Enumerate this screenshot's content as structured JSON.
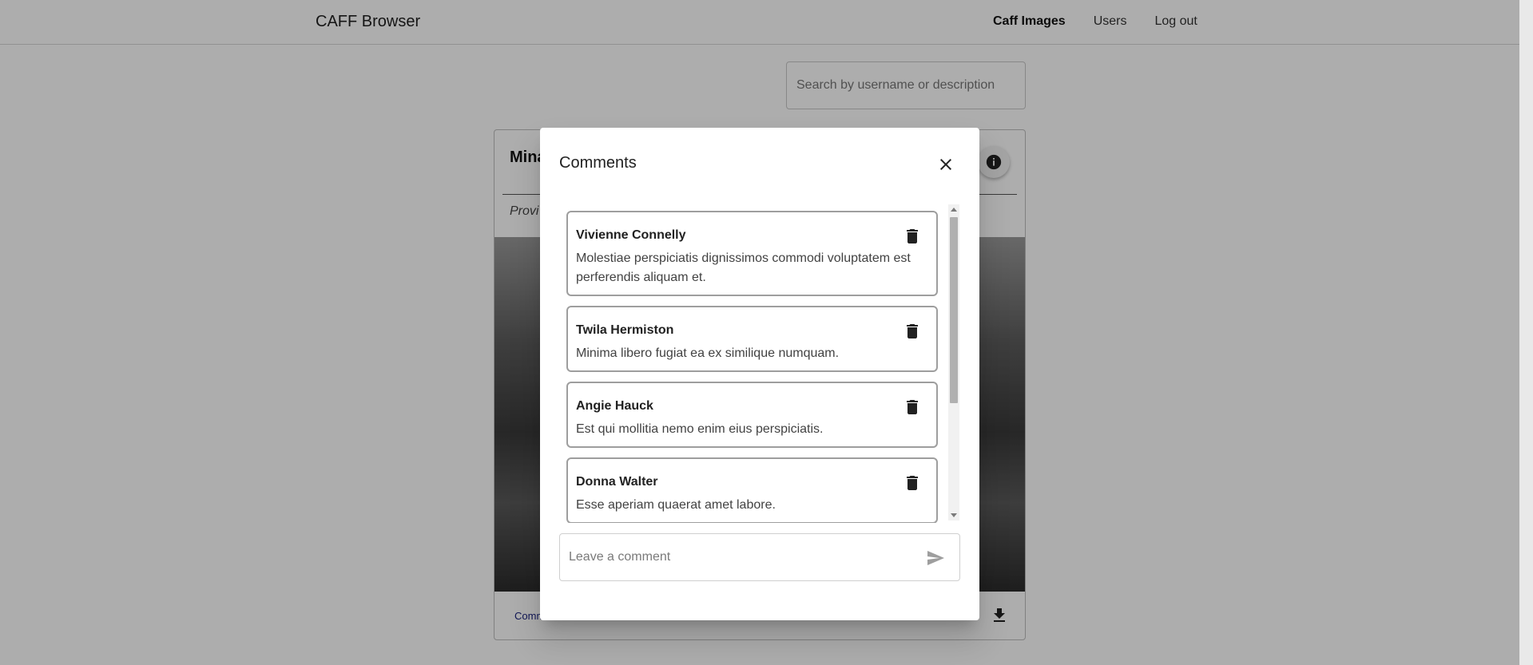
{
  "navbar": {
    "brand": "CAFF Browser",
    "links": [
      {
        "label": "Caff Images",
        "active": true
      },
      {
        "label": "Users",
        "active": false
      },
      {
        "label": "Log out",
        "active": false
      }
    ]
  },
  "search": {
    "placeholder": "Search by username or description",
    "value": ""
  },
  "card": {
    "title_partial": "Mina",
    "subtitle_partial": "Provi",
    "footer_link_partial": "Comm",
    "icons": [
      "info-icon",
      "download-icon"
    ]
  },
  "modal": {
    "title": "Comments",
    "close_icon": "close-icon",
    "comments": [
      {
        "author": "Vivienne Connelly",
        "text": "Molestiae perspiciatis dignissimos commodi voluptatem est perferendis aliquam et."
      },
      {
        "author": "Twila Hermiston",
        "text": "Minima libero fugiat ea ex similique numquam."
      },
      {
        "author": "Angie Hauck",
        "text": "Est qui mollitia nemo enim eius perspiciatis."
      },
      {
        "author": "Donna Walter",
        "text": "Esse aperiam quaerat amet labore."
      }
    ],
    "delete_icon": "trash-icon",
    "comment_input": {
      "placeholder": "Leave a comment",
      "value": ""
    },
    "send_icon": "send-icon"
  },
  "colors": {
    "overlay": "#000000",
    "border": "#9e9e9e",
    "link": "#1a237e"
  }
}
